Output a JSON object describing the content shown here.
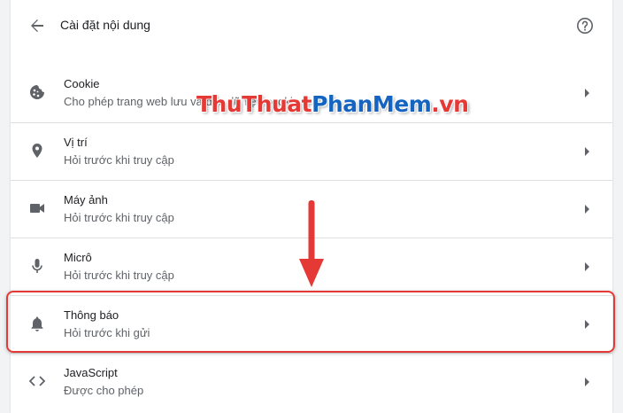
{
  "header": {
    "title": "Cài đặt nội dung",
    "back_icon": "arrow-back-icon",
    "help_icon": "help-circle-icon"
  },
  "items": [
    {
      "id": "cookie",
      "title": "Cookie",
      "subtitle": "Cho phép trang web lưu và đọc dữ liệu cookie",
      "icon": "cookie-icon"
    },
    {
      "id": "location",
      "title": "Vị trí",
      "subtitle": "Hỏi trước khi truy cập",
      "icon": "location-pin-icon"
    },
    {
      "id": "camera",
      "title": "Máy ảnh",
      "subtitle": "Hỏi trước khi truy cập",
      "icon": "videocam-icon"
    },
    {
      "id": "microphone",
      "title": "Micrô",
      "subtitle": "Hỏi trước khi truy cập",
      "icon": "microphone-icon"
    },
    {
      "id": "notifications",
      "title": "Thông báo",
      "subtitle": "Hỏi trước khi gửi",
      "icon": "bell-icon"
    },
    {
      "id": "javascript",
      "title": "JavaScript",
      "subtitle": "Được cho phép",
      "icon": "code-icon"
    }
  ],
  "watermark": {
    "part1": "ThuThuat",
    "part2": "PhanMem",
    "part3": ".vn"
  },
  "annotation": {
    "color": "#e53935"
  },
  "colors": {
    "text_primary": "#202124",
    "text_secondary": "#5f6368",
    "icon": "#5f6368",
    "divider": "#e0e0e0"
  }
}
